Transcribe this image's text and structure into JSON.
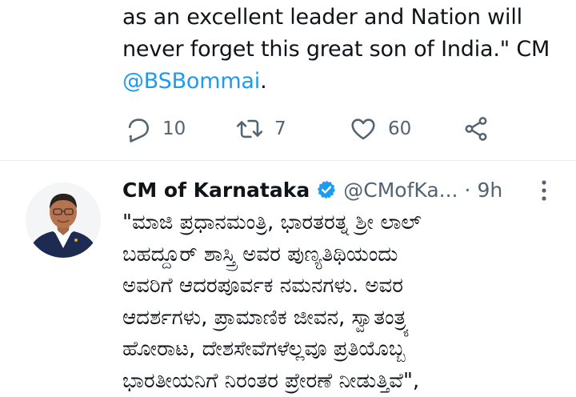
{
  "tweet_top": {
    "text_lines": [
      "as an excellent leader and Nation will",
      "never forget this great son of India.\" CM"
    ],
    "mention": "@BSBommai",
    "mention_suffix": ".",
    "replies": "10",
    "retweets": "7",
    "likes": "60"
  },
  "tweet_main": {
    "display_name": "CM of Karnataka",
    "handle": "@CMofKa...",
    "separator": "·",
    "time": "9h",
    "text_lines": [
      "\"ಮಾಜಿ ಪ್ರಧಾನಮಂತ್ರಿ, ಭಾರತರತ್ನ ಶ್ರೀ ಲಾಲ್",
      "ಬಹದ್ದೂರ್ ಶಾಸ್ತ್ರಿ ಅವರ ಪುಣ್ಯತಿಥಿಯಂದು",
      "ಅವರಿಗೆ ಆದರಪೂರ್ವಕ ನಮನಗಳು. ಅವರ",
      "ಆದರ್ಶಗಳು, ಪ್ರಾಮಾಣಿಕ ಜೀವನ, ಸ್ವಾತಂತ್ರ್ಯ",
      "ಹೋರಾಟ, ದೇಶಸೇವೆಗಳೆಲ್ಲವೂ ಪ್ರತಿಯೊಬ್ಬ",
      "ಭಾರತೀಯನಿಗೆ ನಿರಂತರ ಪ್ರೇರಣೆ ನೀಡುತ್ತಿವೆ\","
    ]
  },
  "colors": {
    "accent": "#1d9bf0",
    "secondary_text": "#536471",
    "divider": "#e6ecf0"
  },
  "icons": {
    "reply": "reply-icon",
    "retweet": "retweet-icon",
    "like": "heart-icon",
    "share": "share-icon",
    "verified": "verified-badge-icon",
    "more": "more-options-icon"
  }
}
